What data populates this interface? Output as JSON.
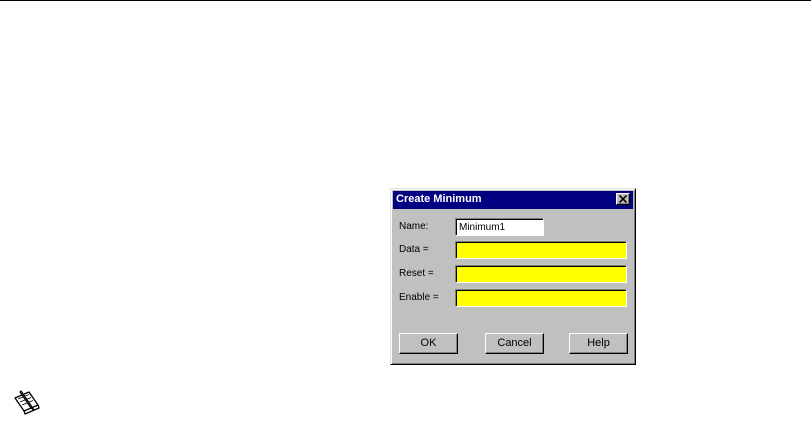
{
  "dialog": {
    "title": "Create Minimum",
    "close_icon": "close-icon",
    "fields": {
      "name_label": "Name:",
      "name_value": "Minimum1",
      "data_label": "Data =",
      "data_value": "",
      "reset_label": "Reset =",
      "reset_value": "",
      "enable_label": "Enable =",
      "enable_value": ""
    },
    "buttons": {
      "ok": "OK",
      "cancel": "Cancel",
      "help": "Help"
    }
  },
  "colors": {
    "titlebar": "#000080",
    "dialog_face": "#c0c0c0",
    "expression_field": "#ffff00"
  },
  "icons": {
    "note": "note-icon"
  }
}
